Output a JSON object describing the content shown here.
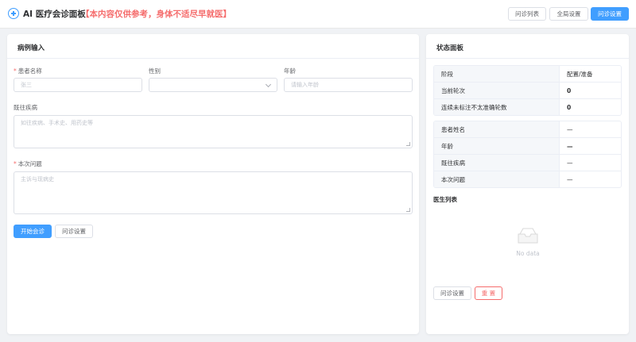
{
  "header": {
    "title": "AI 医疗会诊面板",
    "warning": "【本内容仅供参考，身体不适尽早就医】",
    "buttons": {
      "list": "问诊列表",
      "global": "全局设置",
      "consult": "问诊设置"
    }
  },
  "left_panel": {
    "title": "病例输入",
    "fields": {
      "name": {
        "label": "患者名称",
        "placeholder": "张三"
      },
      "gender": {
        "label": "性别",
        "value": ""
      },
      "age": {
        "label": "年龄",
        "placeholder": "请输入年龄"
      },
      "history": {
        "label": "既往疾病",
        "placeholder": "如往疾病、手术史、用药史等"
      },
      "question": {
        "label": "本次问题",
        "placeholder": "主诉与现病史"
      }
    },
    "buttons": {
      "start": "开始会诊",
      "settings": "问诊设置"
    }
  },
  "right_panel": {
    "title": "状态面板",
    "status": [
      {
        "key": "阶段",
        "value": "配置/准备"
      },
      {
        "key": "当前轮次",
        "value": "0"
      },
      {
        "key": "连续未标注不太准确轮数",
        "value": "0"
      }
    ],
    "patient": [
      {
        "key": "患者姓名",
        "value": "—"
      },
      {
        "key": "年龄",
        "value": "—"
      },
      {
        "key": "既往疾病",
        "value": "—"
      },
      {
        "key": "本次问题",
        "value": "—"
      }
    ],
    "doctors_label": "医生列表",
    "empty_text": "No data",
    "buttons": {
      "settings": "问诊设置",
      "reset": "重 置"
    }
  },
  "colors": {
    "primary": "#409eff",
    "danger": "#f56c6c",
    "border": "#dcdfe6"
  }
}
